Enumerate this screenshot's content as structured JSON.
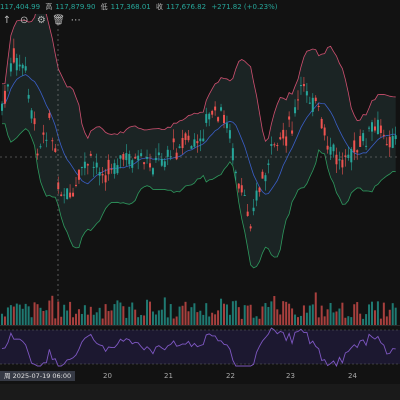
{
  "ohlc": {
    "high_label": "高",
    "high_value": "117,879.90",
    "low_label": "低",
    "low_value": "117,368.01",
    "close_label": "收",
    "close_value": "117,676.82",
    "change": "+271.82 (+0.23%)",
    "truncated_value": "117,404.99"
  },
  "toolbar": {
    "icons": [
      "up-arrow-icon",
      "eye-icon",
      "gear-icon",
      "delete-icon",
      "more-icon"
    ],
    "glyphs": [
      "↑",
      "⊙",
      "⚙",
      "🗑",
      "⋯"
    ]
  },
  "xaxis": {
    "time_badge": "周 2025-07-19   06:00",
    "labels": [
      "20",
      "21",
      "22",
      "23",
      "24"
    ]
  },
  "colors": {
    "up": "#26a69a",
    "down": "#ef5350",
    "upper_band": "#d05070",
    "lower_band": "#2e9a5e",
    "mid_band": "#3a5fc8",
    "rsi": "#7e57c2",
    "background": "#121212"
  }
}
